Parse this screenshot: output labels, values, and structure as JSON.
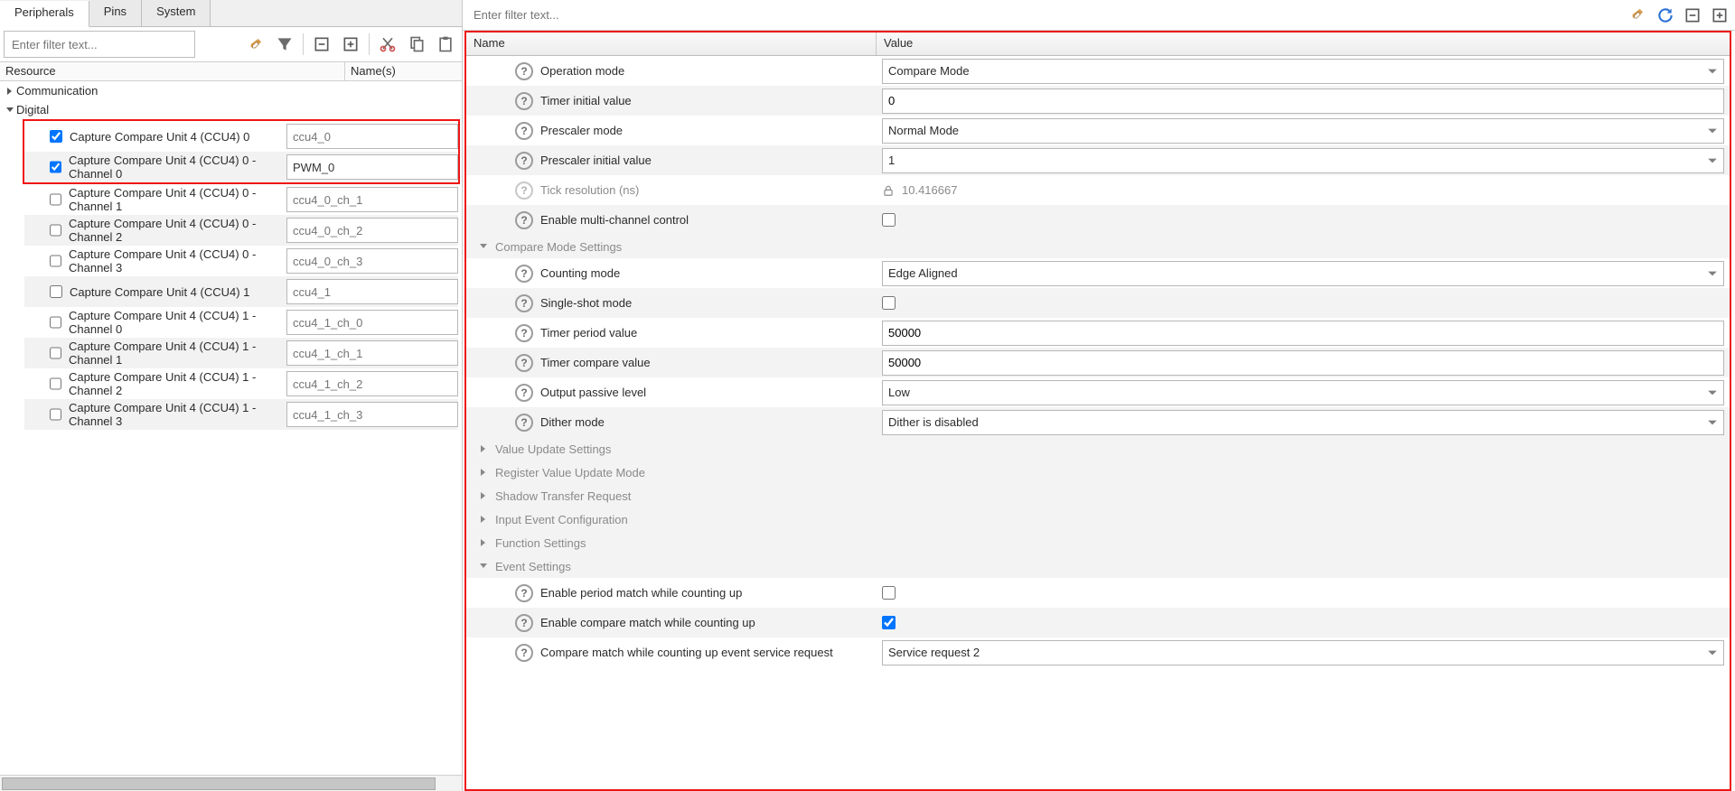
{
  "tabs": {
    "peripherals": "Peripherals",
    "pins": "Pins",
    "system": "System"
  },
  "left": {
    "filter_placeholder": "Enter filter text...",
    "cols": {
      "resource": "Resource",
      "names": "Name(s)"
    },
    "cats": {
      "communication": "Communication",
      "digital": "Digital"
    },
    "rows": [
      {
        "label": "Capture Compare Unit 4 (CCU4) 0",
        "checked": true,
        "name": "ccu4_0",
        "name_is_placeholder": true,
        "alt": false,
        "inside_highlight": true
      },
      {
        "label": "Capture Compare Unit 4 (CCU4) 0 - Channel 0",
        "checked": true,
        "name": "PWM_0",
        "name_is_placeholder": false,
        "alt": true,
        "inside_highlight": true
      },
      {
        "label": "Capture Compare Unit 4 (CCU4) 0 - Channel 1",
        "checked": false,
        "name": "ccu4_0_ch_1",
        "name_is_placeholder": true,
        "alt": false,
        "inside_highlight": false
      },
      {
        "label": "Capture Compare Unit 4 (CCU4) 0 - Channel 2",
        "checked": false,
        "name": "ccu4_0_ch_2",
        "name_is_placeholder": true,
        "alt": true,
        "inside_highlight": false
      },
      {
        "label": "Capture Compare Unit 4 (CCU4) 0 - Channel 3",
        "checked": false,
        "name": "ccu4_0_ch_3",
        "name_is_placeholder": true,
        "alt": false,
        "inside_highlight": false
      },
      {
        "label": "Capture Compare Unit 4 (CCU4) 1",
        "checked": false,
        "name": "ccu4_1",
        "name_is_placeholder": true,
        "alt": true,
        "inside_highlight": false
      },
      {
        "label": "Capture Compare Unit 4 (CCU4) 1 - Channel 0",
        "checked": false,
        "name": "ccu4_1_ch_0",
        "name_is_placeholder": true,
        "alt": false,
        "inside_highlight": false
      },
      {
        "label": "Capture Compare Unit 4 (CCU4) 1 - Channel 1",
        "checked": false,
        "name": "ccu4_1_ch_1",
        "name_is_placeholder": true,
        "alt": true,
        "inside_highlight": false
      },
      {
        "label": "Capture Compare Unit 4 (CCU4) 1 - Channel 2",
        "checked": false,
        "name": "ccu4_1_ch_2",
        "name_is_placeholder": true,
        "alt": false,
        "inside_highlight": false
      },
      {
        "label": "Capture Compare Unit 4 (CCU4) 1 - Channel 3",
        "checked": false,
        "name": "ccu4_1_ch_3",
        "name_is_placeholder": true,
        "alt": true,
        "inside_highlight": false
      }
    ]
  },
  "right": {
    "filter_placeholder": "Enter filter text...",
    "cols": {
      "name": "Name",
      "value": "Value"
    },
    "sections": {
      "compare_mode": "Compare Mode Settings",
      "value_update": "Value Update Settings",
      "register_mode": "Register Value Update Mode",
      "shadow": "Shadow Transfer Request",
      "input_event": "Input Event Configuration",
      "function": "Function Settings",
      "event": "Event Settings"
    },
    "props": {
      "operation_mode": {
        "label": "Operation mode",
        "value": "Compare Mode",
        "type": "select"
      },
      "timer_initial": {
        "label": "Timer initial value",
        "value": "0",
        "type": "text"
      },
      "prescaler_mode": {
        "label": "Prescaler mode",
        "value": "Normal Mode",
        "type": "select"
      },
      "prescaler_initial": {
        "label": "Prescaler initial value",
        "value": "1",
        "type": "select"
      },
      "tick_resolution": {
        "label": "Tick resolution (ns)",
        "value": "10.416667",
        "type": "readonly"
      },
      "enable_multichannel": {
        "label": "Enable multi-channel control",
        "checked": false,
        "type": "checkbox"
      },
      "counting_mode": {
        "label": "Counting mode",
        "value": "Edge Aligned",
        "type": "select"
      },
      "single_shot": {
        "label": "Single-shot mode",
        "checked": false,
        "type": "checkbox"
      },
      "timer_period": {
        "label": "Timer period value",
        "value": "50000",
        "type": "text"
      },
      "timer_compare": {
        "label": "Timer compare value",
        "value": "50000",
        "type": "text"
      },
      "output_passive": {
        "label": "Output passive level",
        "value": "Low",
        "type": "select"
      },
      "dither_mode": {
        "label": "Dither mode",
        "value": "Dither is disabled",
        "type": "select"
      },
      "enable_period_match_up": {
        "label": "Enable period match while counting up",
        "checked": false,
        "type": "checkbox"
      },
      "enable_compare_match_up": {
        "label": "Enable compare match while counting up",
        "checked": true,
        "type": "checkbox"
      },
      "compare_match_up_request": {
        "label": "Compare match while counting up event service request",
        "value": "Service request 2",
        "type": "select"
      }
    }
  }
}
